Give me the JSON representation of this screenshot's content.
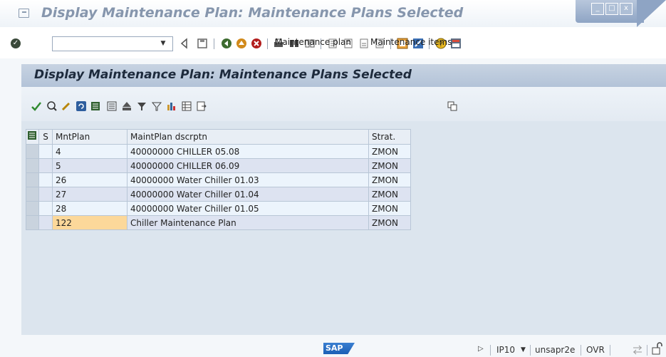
{
  "window": {
    "title": "Display Maintenance Plan: Maintenance Plans Selected",
    "controls": {
      "minimize": "_",
      "maximize": "□",
      "close": "x"
    }
  },
  "system_toolbar": {
    "command_field": {
      "value": "",
      "placeholder": ""
    },
    "icons": [
      "enter-icon",
      "back-icon",
      "exit-icon",
      "cancel-icon",
      "print-icon",
      "find-icon",
      "find-next-icon",
      "first-page-icon",
      "previous-page-icon",
      "next-page-icon",
      "last-page-icon",
      "new-session-icon",
      "shortcut-icon",
      "help-icon",
      "customize-layout-icon"
    ]
  },
  "panel": {
    "title": "Display Maintenance Plan: Maintenance Plans Selected",
    "app_toolbar": {
      "maintenance_plan": "Maintenance plan",
      "maintenance_items": "Maintenance items"
    }
  },
  "table": {
    "columns": [
      "S",
      "MntPlan",
      "MaintPlan dscrptn",
      "Strat."
    ],
    "rows": [
      {
        "s": "",
        "plan": "4",
        "desc": "40000000 CHILLER  05.08",
        "strat": "ZMON"
      },
      {
        "s": "",
        "plan": "5",
        "desc": "40000000 CHILLER  06.09",
        "strat": "ZMON"
      },
      {
        "s": "",
        "plan": "26",
        "desc": "40000000 Water Chiller 01.03",
        "strat": "ZMON"
      },
      {
        "s": "",
        "plan": "27",
        "desc": "40000000 Water Chiller 01.04",
        "strat": "ZMON"
      },
      {
        "s": "",
        "plan": "28",
        "desc": "40000000 Water Chiller 01.05",
        "strat": "ZMON"
      },
      {
        "s": "",
        "plan": "122",
        "desc": "Chiller Maintenance Plan",
        "strat": "ZMON"
      }
    ]
  },
  "status_bar": {
    "logo": "SAP",
    "system": "IP10",
    "server": "unsapr2e",
    "mode": "OVR"
  },
  "colors": {
    "title_text": "#8696ad",
    "panel_bg": "#dce5ee",
    "highlight_cell": "#fcd89a",
    "row_alt": "#dde3f1",
    "row": "#ecf4fc"
  }
}
